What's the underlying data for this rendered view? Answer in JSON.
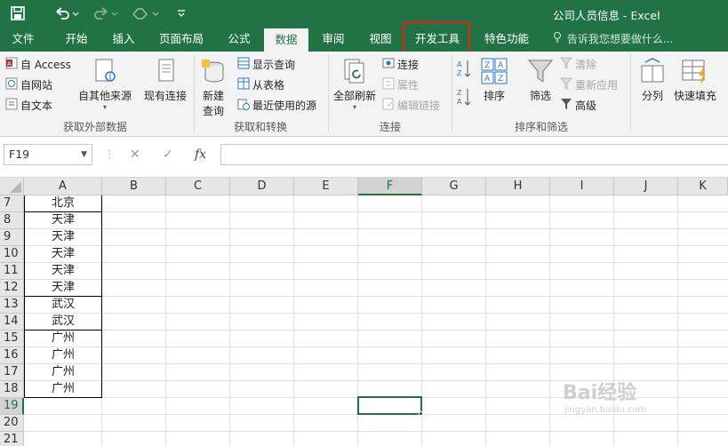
{
  "window": {
    "title": "公司人员信息 - Excel",
    "quick_access": {
      "save": "save-icon",
      "undo": "undo-icon",
      "redo": "redo-icon",
      "touch": "touch-mode-icon",
      "customize": "customize-icon"
    }
  },
  "tabs": [
    {
      "label": "文件",
      "active": false
    },
    {
      "label": "开始",
      "active": false
    },
    {
      "label": "插入",
      "active": false
    },
    {
      "label": "页面布局",
      "active": false
    },
    {
      "label": "公式",
      "active": false
    },
    {
      "label": "数据",
      "active": true
    },
    {
      "label": "审阅",
      "active": false
    },
    {
      "label": "视图",
      "active": false
    },
    {
      "label": "开发工具",
      "active": false,
      "highlighted": true
    },
    {
      "label": "特色功能",
      "active": false
    }
  ],
  "tell_me": "告诉我您想要做什么...",
  "ribbon": {
    "get_external": {
      "access": "自 Access",
      "web": "自网站",
      "text": "自文本",
      "other": "自其他来源",
      "existing": "现有连接",
      "label": "获取外部数据"
    },
    "transform": {
      "new_query_1": "新建",
      "new_query_2": "查询",
      "show_queries": "显示查询",
      "from_table": "从表格",
      "recent_sources": "最近使用的源",
      "label": "获取和转换"
    },
    "connections": {
      "refresh_all": "全部刷新",
      "connections": "连接",
      "properties": "属性",
      "edit_links": "编辑链接",
      "label": "连接"
    },
    "sort_filter": {
      "sort": "排序",
      "filter": "筛选",
      "clear": "清除",
      "reapply": "重新应用",
      "advanced": "高级",
      "label": "排序和筛选"
    },
    "data_tools": {
      "split": "分列",
      "flash_fill": "快速填充"
    }
  },
  "formula_bar": {
    "name_box": "F19",
    "fx": "fx",
    "formula": ""
  },
  "columns": [
    "A",
    "B",
    "C",
    "D",
    "E",
    "F",
    "G",
    "H",
    "I",
    "J",
    "K"
  ],
  "selected_column": "F",
  "rows": [
    {
      "num": "7",
      "a": "北京"
    },
    {
      "num": "8",
      "a": "天津"
    },
    {
      "num": "9",
      "a": "天津"
    },
    {
      "num": "10",
      "a": "天津"
    },
    {
      "num": "11",
      "a": "天津"
    },
    {
      "num": "12",
      "a": "天津"
    },
    {
      "num": "13",
      "a": "武汉"
    },
    {
      "num": "14",
      "a": "武汉"
    },
    {
      "num": "15",
      "a": "广州"
    },
    {
      "num": "16",
      "a": "广州"
    },
    {
      "num": "17",
      "a": "广州"
    },
    {
      "num": "18",
      "a": "广州"
    },
    {
      "num": "19",
      "a": ""
    },
    {
      "num": "20",
      "a": ""
    },
    {
      "num": "21",
      "a": ""
    }
  ],
  "selected_row": "19",
  "watermark": {
    "main": "Bai经验",
    "sub": "jingyan.baidu.com"
  },
  "colors": {
    "excel_green": "#217346",
    "highlight_red": "#e8201a"
  }
}
